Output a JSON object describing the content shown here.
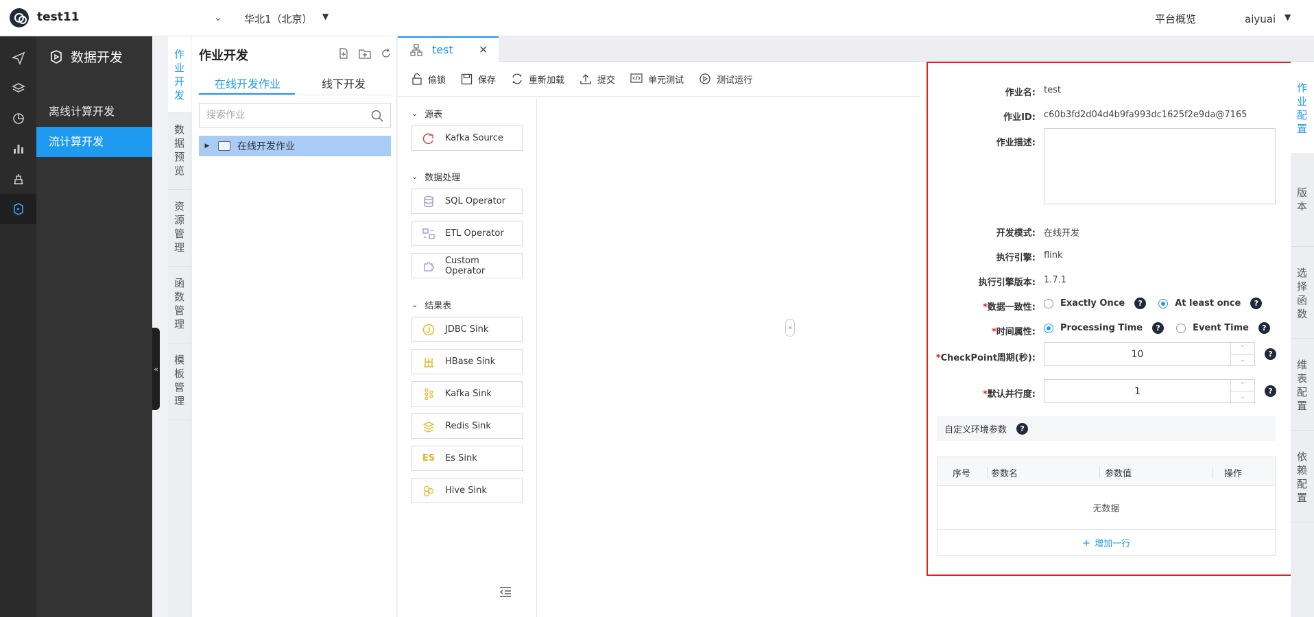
{
  "header": {
    "app_title": "test11",
    "region": "华北1（北京）",
    "overview": "平台概览",
    "user": "aiyuai"
  },
  "rail": {
    "icons": [
      "send-icon",
      "layers-icon",
      "chart-pie-icon",
      "dashboard-icon",
      "ops-icon",
      "dev-icon"
    ]
  },
  "modnav": {
    "title": "数据开发",
    "items": [
      {
        "label": "离线计算开发"
      },
      {
        "label": "流计算开发"
      }
    ]
  },
  "vtabs": [
    {
      "label": "作业开发"
    },
    {
      "label": "数据预览"
    },
    {
      "label": "资源管理"
    },
    {
      "label": "函数管理"
    },
    {
      "label": "模板管理"
    }
  ],
  "jobpanel": {
    "title": "作业开发",
    "tabs": [
      {
        "label": "在线开发作业"
      },
      {
        "label": "线下开发"
      }
    ],
    "search_placeholder": "搜索作业",
    "tree_root": "在线开发作业"
  },
  "editor": {
    "tab_label": "test",
    "toolbar": {
      "lock": "偷锁",
      "save": "保存",
      "reload": "重新加载",
      "submit": "提交",
      "unit_test": "单元测试",
      "test_run": "测试运行"
    }
  },
  "palette": {
    "sections": [
      {
        "label": "源表",
        "items": [
          "Kafka Source"
        ]
      },
      {
        "label": "数据处理",
        "items": [
          "SQL Operator",
          "ETL Operator",
          "Custom Operator"
        ]
      },
      {
        "label": "结果表",
        "items": [
          "JDBC Sink",
          "HBase Sink",
          "Kafka Sink",
          "Redis Sink",
          "Es Sink",
          "Hive Sink"
        ]
      }
    ],
    "es_badge": "ES"
  },
  "config": {
    "job_name_label": "作业名:",
    "job_name": "test",
    "job_id_label": "作业ID:",
    "job_id": "c60b3fd2d04d4b9fa993dc1625f2e9da@7165",
    "desc_label": "作业描述:",
    "dev_mode_label": "开发模式:",
    "dev_mode": "在线开发",
    "engine_label": "执行引擎:",
    "engine": "flink",
    "engine_version_label": "执行引擎版本:",
    "engine_version": "1.7.1",
    "consistency_label": "数据一致性:",
    "consistency_options": [
      "Exactly Once",
      "At least once"
    ],
    "time_label": "时间属性:",
    "time_options": [
      "Processing Time",
      "Event Time"
    ],
    "checkpoint_label": "CheckPoint周期(秒):",
    "checkpoint_value": "10",
    "parallelism_label": "默认并行度:",
    "parallelism_value": "1",
    "env_params_label": "自定义环境参数",
    "table_cols": [
      "序号",
      "参数名",
      "参数值",
      "操作"
    ],
    "empty_text": "无数据",
    "add_row": "增加一行"
  },
  "rtabs": [
    {
      "label": "作业配置"
    },
    {
      "label": "版本"
    },
    {
      "label": "选择函数"
    },
    {
      "label": "维表配置"
    },
    {
      "label": "依赖配置"
    }
  ],
  "colors": {
    "accent": "#1e9bf0",
    "highlight_border": "#e02020",
    "sidebar": "#333333"
  }
}
